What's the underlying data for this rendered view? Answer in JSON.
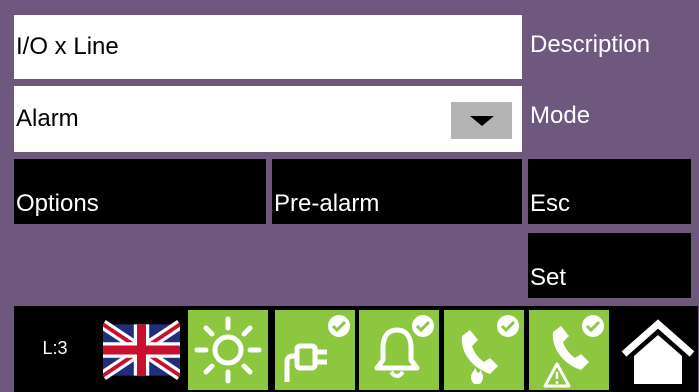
{
  "description": {
    "value": "I/O x Line",
    "label": "Description"
  },
  "mode": {
    "value": "Alarm",
    "label": "Mode"
  },
  "buttons": {
    "options": "Options",
    "prealarm": "Pre-alarm",
    "esc": "Esc",
    "set": "Set"
  },
  "statusbar": {
    "level": "L:3",
    "icons": [
      "uk-flag-icon",
      "sun-icon",
      "power-plug-icon",
      "bell-icon",
      "phone-fire-icon",
      "phone-warning-icon",
      "home-icon"
    ]
  },
  "colors": {
    "background": "#6e587e",
    "tile": "#8dc63f",
    "button": "#000000",
    "field": "#ffffff",
    "dropdown": "#b4b4b4"
  }
}
